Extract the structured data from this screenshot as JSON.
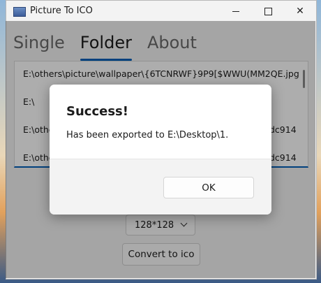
{
  "window": {
    "title": "Picture To ICO",
    "app_icon": "picture-icon",
    "controls": {
      "minimize_icon": "minimize-icon",
      "maximize_icon": "maximize-icon",
      "close_glyph": "✕"
    }
  },
  "tabs": [
    {
      "label": "Single",
      "active": false
    },
    {
      "label": "Folder",
      "active": true
    },
    {
      "label": "About",
      "active": false
    }
  ],
  "file_list": {
    "rows": [
      "E:\\others\\picture\\wallpaper\\{6TCNRWF}9P9[$WWU(MM2QE.jpg",
      "E:\\",
      "E:\\othe",
      "E:\\othe"
    ],
    "row_suffixes": [
      "",
      "",
      "dc914",
      "dc914"
    ]
  },
  "size_select": {
    "value": "128*128"
  },
  "convert_button": {
    "label": "Convert to ico"
  },
  "dialog": {
    "title": "Success!",
    "message": "Has been exported to E:\\Desktop\\1.",
    "ok_label": "OK"
  },
  "colors": {
    "accent": "#005fb8"
  }
}
